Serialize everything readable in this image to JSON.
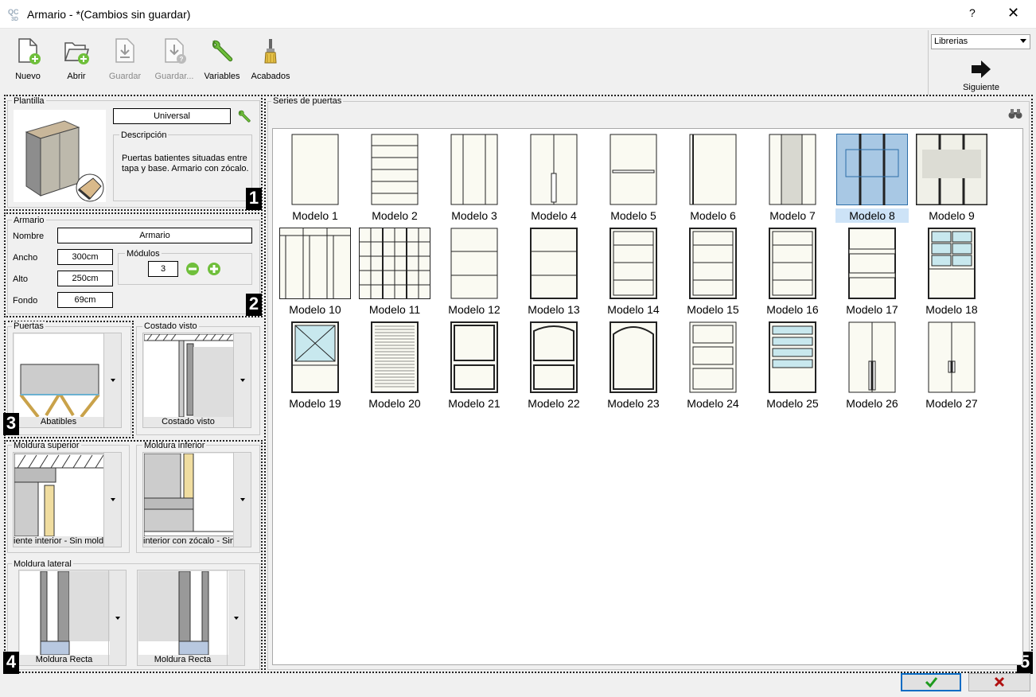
{
  "window": {
    "title": "Armario -  *(Cambios sin guardar)",
    "help": "?",
    "close": "✕"
  },
  "toolbar": {
    "nuevo": "Nuevo",
    "abrir": "Abrir",
    "guardar": "Guardar",
    "guardar_como": "Guardar...",
    "variables": "Variables",
    "acabados": "Acabados"
  },
  "library": {
    "selected": "Librerias",
    "next": "Siguiente"
  },
  "plantilla": {
    "group": "Plantilla",
    "name": "Universal",
    "desc_label": "Descripción",
    "description": "Puertas batientes situadas entre tapa y base. Armario con zócalo."
  },
  "armario": {
    "group": "Armario",
    "nombre_label": "Nombre",
    "nombre": "Armario",
    "ancho_label": "Ancho",
    "ancho": "300cm",
    "alto_label": "Alto",
    "alto": "250cm",
    "fondo_label": "Fondo",
    "fondo": "69cm",
    "modulos_label": "Módulos",
    "modulos": "3"
  },
  "puertas": {
    "group": "Puertas",
    "value": "Abatibles"
  },
  "costado": {
    "group": "Costado visto",
    "value": "Costado visto"
  },
  "moldura_sup": {
    "group": "Moldura superior",
    "value": "iente interior - Sin moldu"
  },
  "moldura_inf": {
    "group": "Moldura inferior",
    "value": "interior con zócalo - Sin"
  },
  "moldura_lat": {
    "group": "Moldura lateral",
    "left": "Moldura Recta",
    "right": "Moldura Recta"
  },
  "series": {
    "group": "Series de puertas",
    "selected": "Modelo 8",
    "models": [
      "Modelo 1",
      "Modelo 2",
      "Modelo 3",
      "Modelo 4",
      "Modelo 5",
      "Modelo 6",
      "Modelo 7",
      "Modelo 8",
      "Modelo 9",
      "Modelo 10",
      "Modelo 11",
      "Modelo 12",
      "Modelo 13",
      "Modelo 14",
      "Modelo 15",
      "Modelo 16",
      "Modelo 17",
      "Modelo 18",
      "Modelo 19",
      "Modelo 20",
      "Modelo 21",
      "Modelo 22",
      "Modelo 23",
      "Modelo 24",
      "Modelo 25",
      "Modelo 26",
      "Modelo 27"
    ]
  },
  "badges": {
    "b1": "1",
    "b2": "2",
    "b3": "3",
    "b4": "4",
    "b5": "5"
  },
  "colors": {
    "accent": "#0b6cc4",
    "selection": "#cde3f7",
    "ok_green": "#1d9a1d",
    "cancel_red": "#b01010",
    "panel_bg": "#f0f0f0"
  },
  "icons": [
    "new-file-icon",
    "open-folder-icon",
    "save-icon",
    "save-as-icon",
    "wrench-icon",
    "brush-icon",
    "arrow-right-icon",
    "binoculars-icon",
    "check-icon",
    "cross-icon"
  ]
}
